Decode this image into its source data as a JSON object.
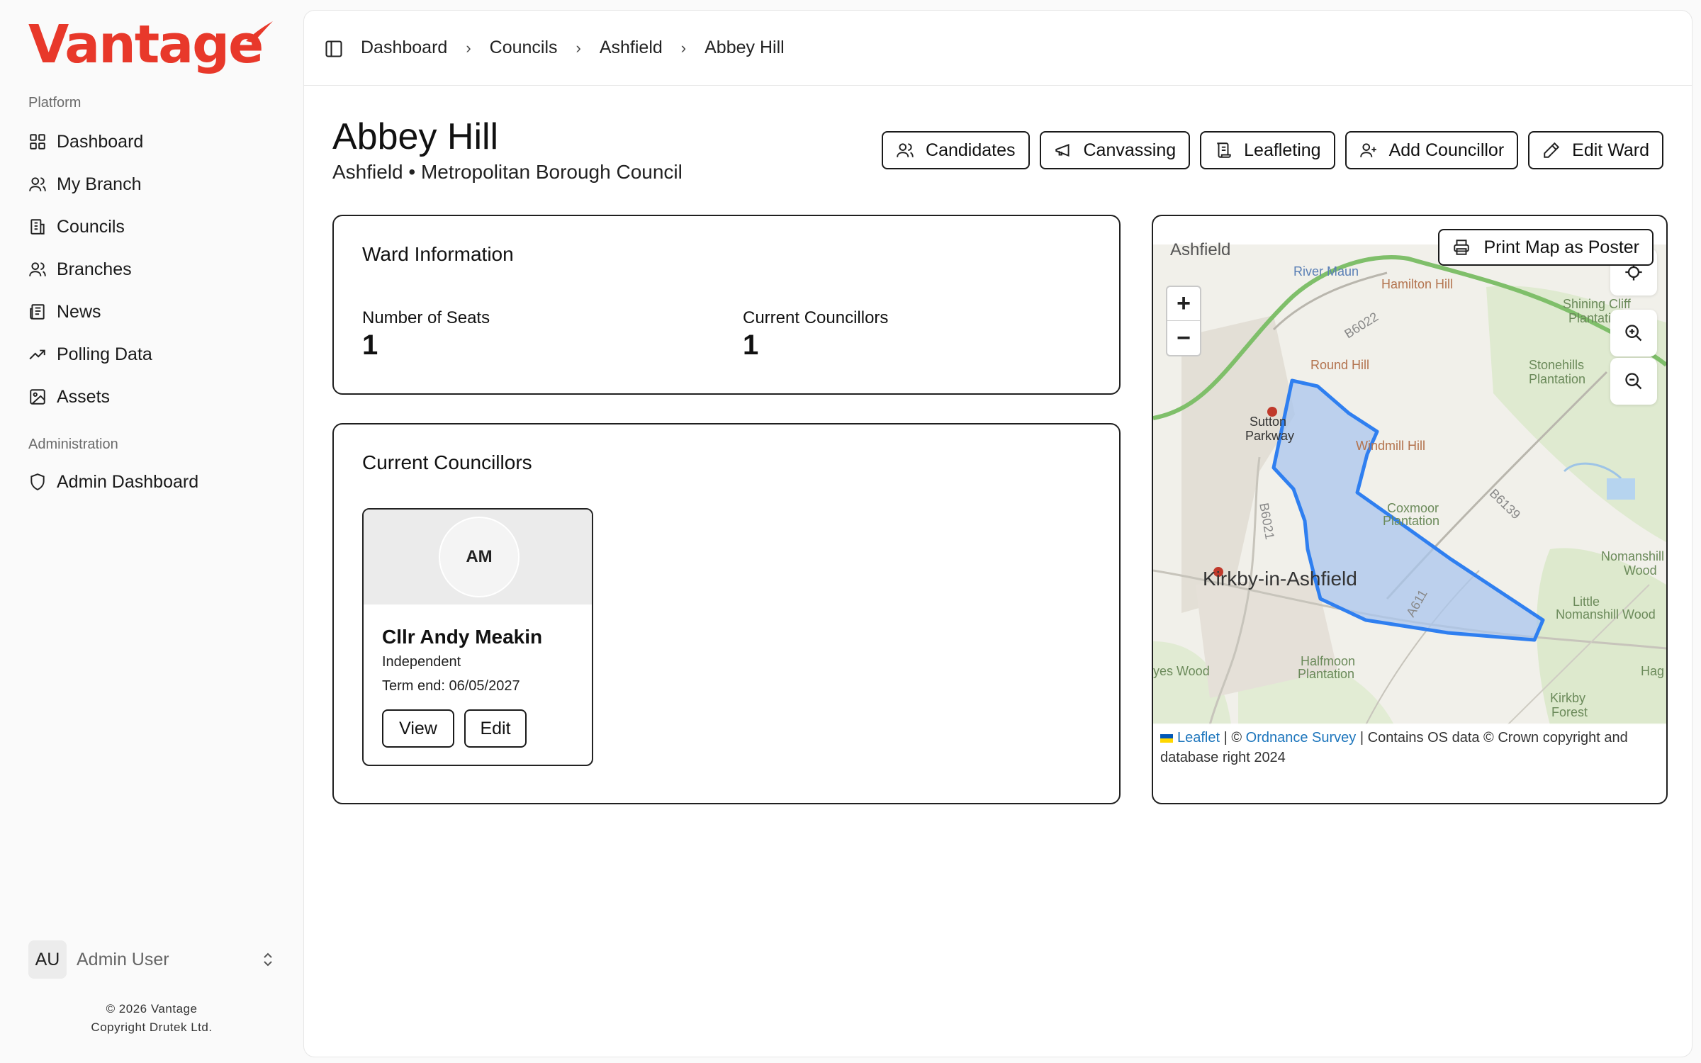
{
  "brand": {
    "name": "Vantage",
    "color": "#e8382a"
  },
  "sidebar": {
    "platform_label": "Platform",
    "admin_label": "Administration",
    "items": [
      {
        "label": "Dashboard",
        "icon": "grid-icon"
      },
      {
        "label": "My Branch",
        "icon": "users-icon"
      },
      {
        "label": "Councils",
        "icon": "building-icon"
      },
      {
        "label": "Branches",
        "icon": "users-icon"
      },
      {
        "label": "News",
        "icon": "newspaper-icon"
      },
      {
        "label": "Polling Data",
        "icon": "trending-up-icon"
      },
      {
        "label": "Assets",
        "icon": "image-icon"
      }
    ],
    "admin_items": [
      {
        "label": "Admin Dashboard",
        "icon": "shield-icon"
      }
    ],
    "user": {
      "initials": "AU",
      "name": "Admin User"
    },
    "footer": {
      "line1": "© 2026 Vantage",
      "line2": "Copyright Drutek Ltd."
    }
  },
  "breadcrumb": [
    "Dashboard",
    "Councils",
    "Ashfield",
    "Abbey Hill"
  ],
  "page": {
    "title": "Abbey Hill",
    "subtitle": "Ashfield • Metropolitan Borough Council"
  },
  "actions": {
    "candidates": "Candidates",
    "canvassing": "Canvassing",
    "leafleting": "Leafleting",
    "add_councillor": "Add Councillor",
    "edit_ward": "Edit Ward"
  },
  "ward_info": {
    "title": "Ward Information",
    "seats_label": "Number of Seats",
    "seats_value": "1",
    "councillors_label": "Current Councillors",
    "councillors_value": "1"
  },
  "councillors": {
    "title": "Current Councillors",
    "items": [
      {
        "initials": "AM",
        "name": "Cllr Andy Meakin",
        "party": "Independent",
        "term": "Term end: 06/05/2027",
        "view_label": "View",
        "edit_label": "Edit"
      }
    ]
  },
  "map": {
    "print_label": "Print Map as Poster",
    "zoom_in": "+",
    "zoom_out": "−",
    "labels": {
      "ashfield": "Ashfield",
      "river_maun": "River Maun",
      "hamilton_hill": "Hamilton Hill",
      "b6022": "B6022",
      "shining_cliff_1": "Shining Cliff",
      "shining_cliff_2": "Plantation",
      "round_hill": "Round Hill",
      "stonehills_1": "Stonehills",
      "stonehills_2": "Plantation",
      "sutton_1": "Sutton",
      "sutton_2": "Parkway",
      "windmill_hill": "Windmill Hill",
      "b6139": "B6139",
      "b6021": "B6021",
      "coxmoor_1": "Coxmoor",
      "coxmoor_2": "Plantation",
      "kirkby": "Kirkby-in-Ashfield",
      "nomanshill_1": "Nomanshill",
      "nomanshill_2": "Wood",
      "little_1": "Little",
      "little_2": "Nomanshill Wood",
      "a611": "A611",
      "yes_wood": "yes Wood",
      "halfmoon_1": "Halfmoon",
      "halfmoon_2": "Plantation",
      "hag": "Hag",
      "kirkby_forest_1": "Kirkby",
      "kirkby_forest_2": "Forest"
    },
    "ward_fill": "#a9c6ee",
    "ward_stroke": "#2f7ff0",
    "attribution": {
      "leaflet": "Leaflet",
      "sep1": " | © ",
      "os": "Ordnance Survey",
      "rest": " | Contains OS data © Crown copyright and database right 2024"
    }
  }
}
